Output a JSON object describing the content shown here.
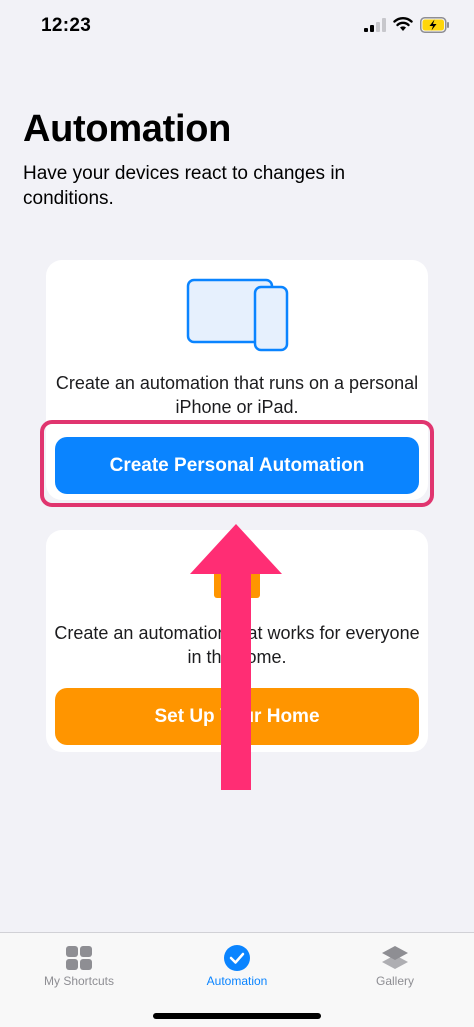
{
  "status_bar": {
    "time": "12:23"
  },
  "header": {
    "title": "Automation",
    "subtitle": "Have your devices react to changes in conditions."
  },
  "personal_card": {
    "description": "Create an automation that runs on a personal iPhone or iPad.",
    "button_label": "Create Personal Automation"
  },
  "home_card": {
    "description": "Create an automation that works for everyone in the home.",
    "button_label": "Set Up Your Home"
  },
  "tab_bar": {
    "tabs": [
      {
        "label": "My Shortcuts",
        "icon": "grid-icon",
        "active": false
      },
      {
        "label": "Automation",
        "icon": "clock-check-icon",
        "active": true
      },
      {
        "label": "Gallery",
        "icon": "layers-icon",
        "active": false
      }
    ]
  },
  "colors": {
    "accent_blue": "#0a84ff",
    "home_orange": "#ff9500",
    "annotation_pink": "#e0356f",
    "background": "#f2f2f7"
  }
}
